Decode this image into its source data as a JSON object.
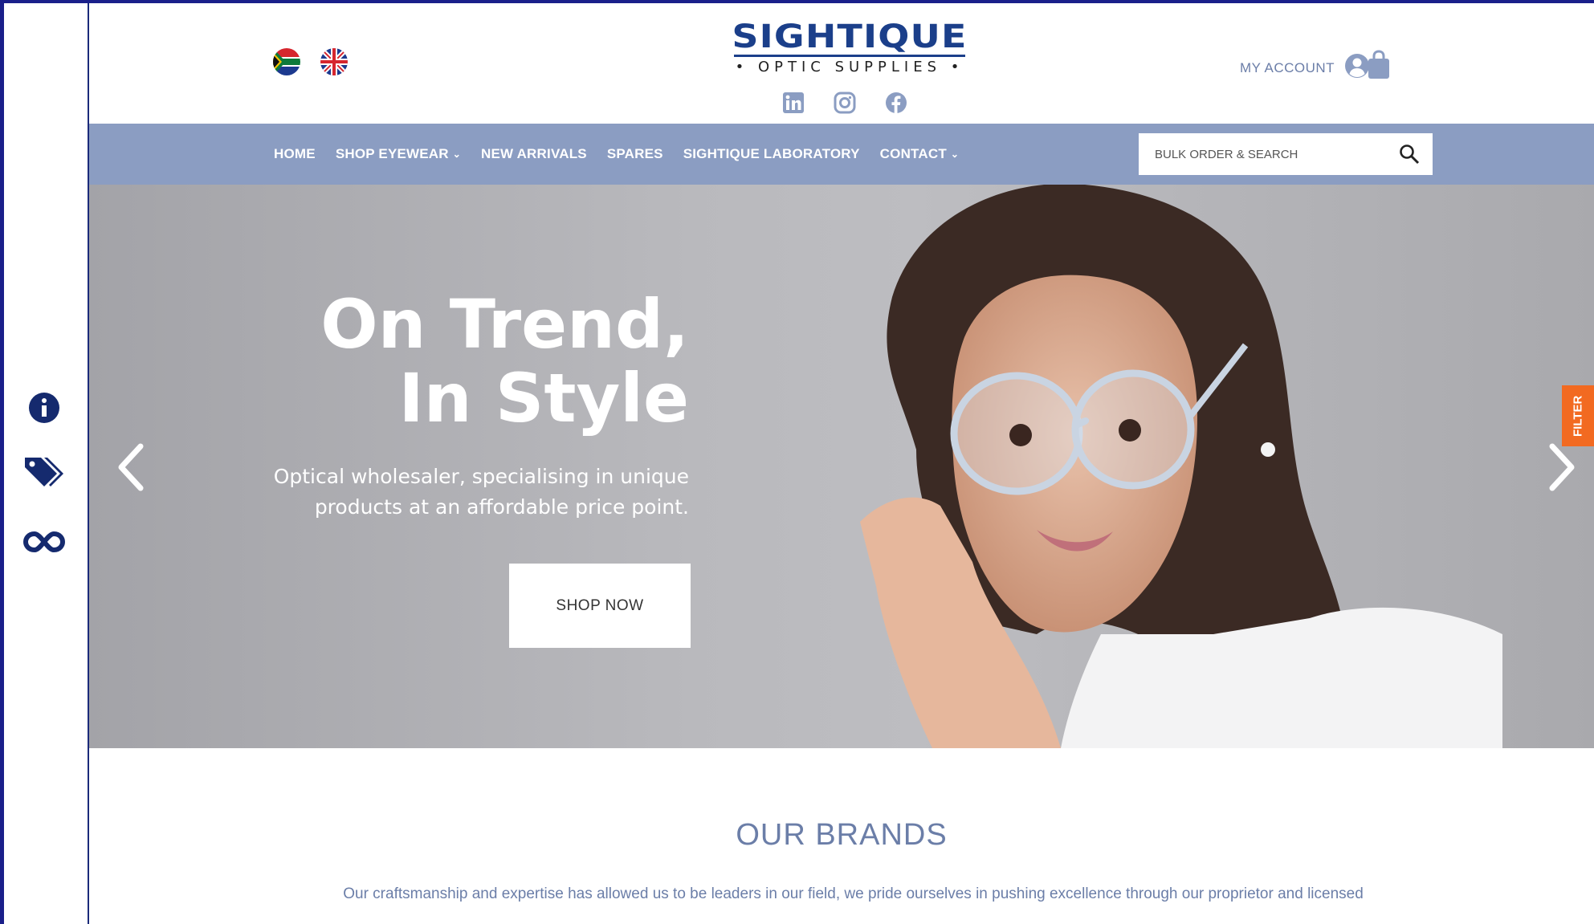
{
  "header": {
    "logo": {
      "title": "SIGHTIQUE",
      "subtitle": "• OPTIC SUPPLIES •"
    },
    "flags": [
      {
        "icon": "south-africa-flag-icon"
      },
      {
        "icon": "uk-flag-icon"
      }
    ],
    "socials": [
      {
        "icon": "linkedin-icon"
      },
      {
        "icon": "instagram-icon"
      },
      {
        "icon": "facebook-icon"
      }
    ],
    "account_label": "MY ACCOUNT"
  },
  "nav": {
    "items": [
      {
        "label": "HOME"
      },
      {
        "label": "SHOP EYEWEAR",
        "chevron": "⌄"
      },
      {
        "label": "NEW ARRIVALS"
      },
      {
        "label": "SPARES"
      },
      {
        "label": "SIGHTIQUE LABORATORY"
      },
      {
        "label": "CONTACT",
        "chevron": "⌄"
      }
    ],
    "search_placeholder": "BULK ORDER & SEARCH"
  },
  "hero": {
    "title_line1": "On Trend,",
    "title_line2": "In Style",
    "subtitle_line1": "Optical wholesaler, specialising in unique",
    "subtitle_line2": "products at an affordable price point.",
    "cta": "SHOP NOW",
    "filter_label": "FILTER"
  },
  "rail": {
    "icons": [
      "info-icon",
      "tags-icon",
      "infinity-icon"
    ]
  },
  "brands": {
    "title": "OUR BRANDS",
    "text": "Our craftsmanship and expertise has allowed us to be leaders in our field, we pride ourselves in pushing excellence through our proprietor and licensed"
  },
  "colors": {
    "brand": "#1b3f8a",
    "nav": "#8b9dc2",
    "accent": "#f26a21",
    "text_muted": "#6b7ea8"
  }
}
